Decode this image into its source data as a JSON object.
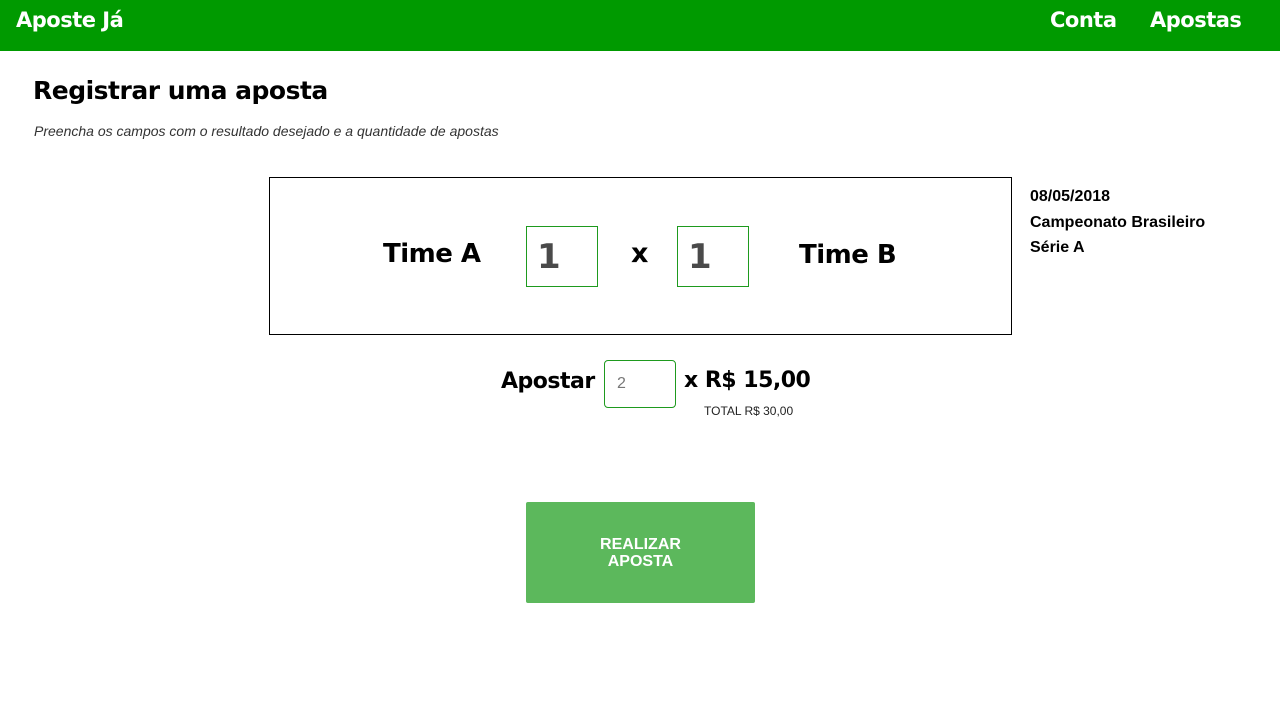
{
  "navbar": {
    "brand": "Aposte Já",
    "links": [
      {
        "label": "Conta"
      },
      {
        "label": "Apostas"
      }
    ],
    "color": "#009a00"
  },
  "header": {
    "title": "Registrar uma aposta",
    "subtitle": "Preencha os campos com o resultado desejado e a quantidade de apostas"
  },
  "match": {
    "team_a": "Time A",
    "team_b": "Time B",
    "score_a": "1",
    "score_b": "1",
    "versus": "x",
    "date": "08/05/2018",
    "league": "Campeonato Brasileiro Série A"
  },
  "bet": {
    "label": "Apostar",
    "quantity_placeholder": "2",
    "price": "x R$ 15,00",
    "total": "TOTAL R$ 30,00"
  },
  "actions": {
    "submit_label": "REALIZAR APOSTA",
    "button_color": "#5cb85c"
  }
}
